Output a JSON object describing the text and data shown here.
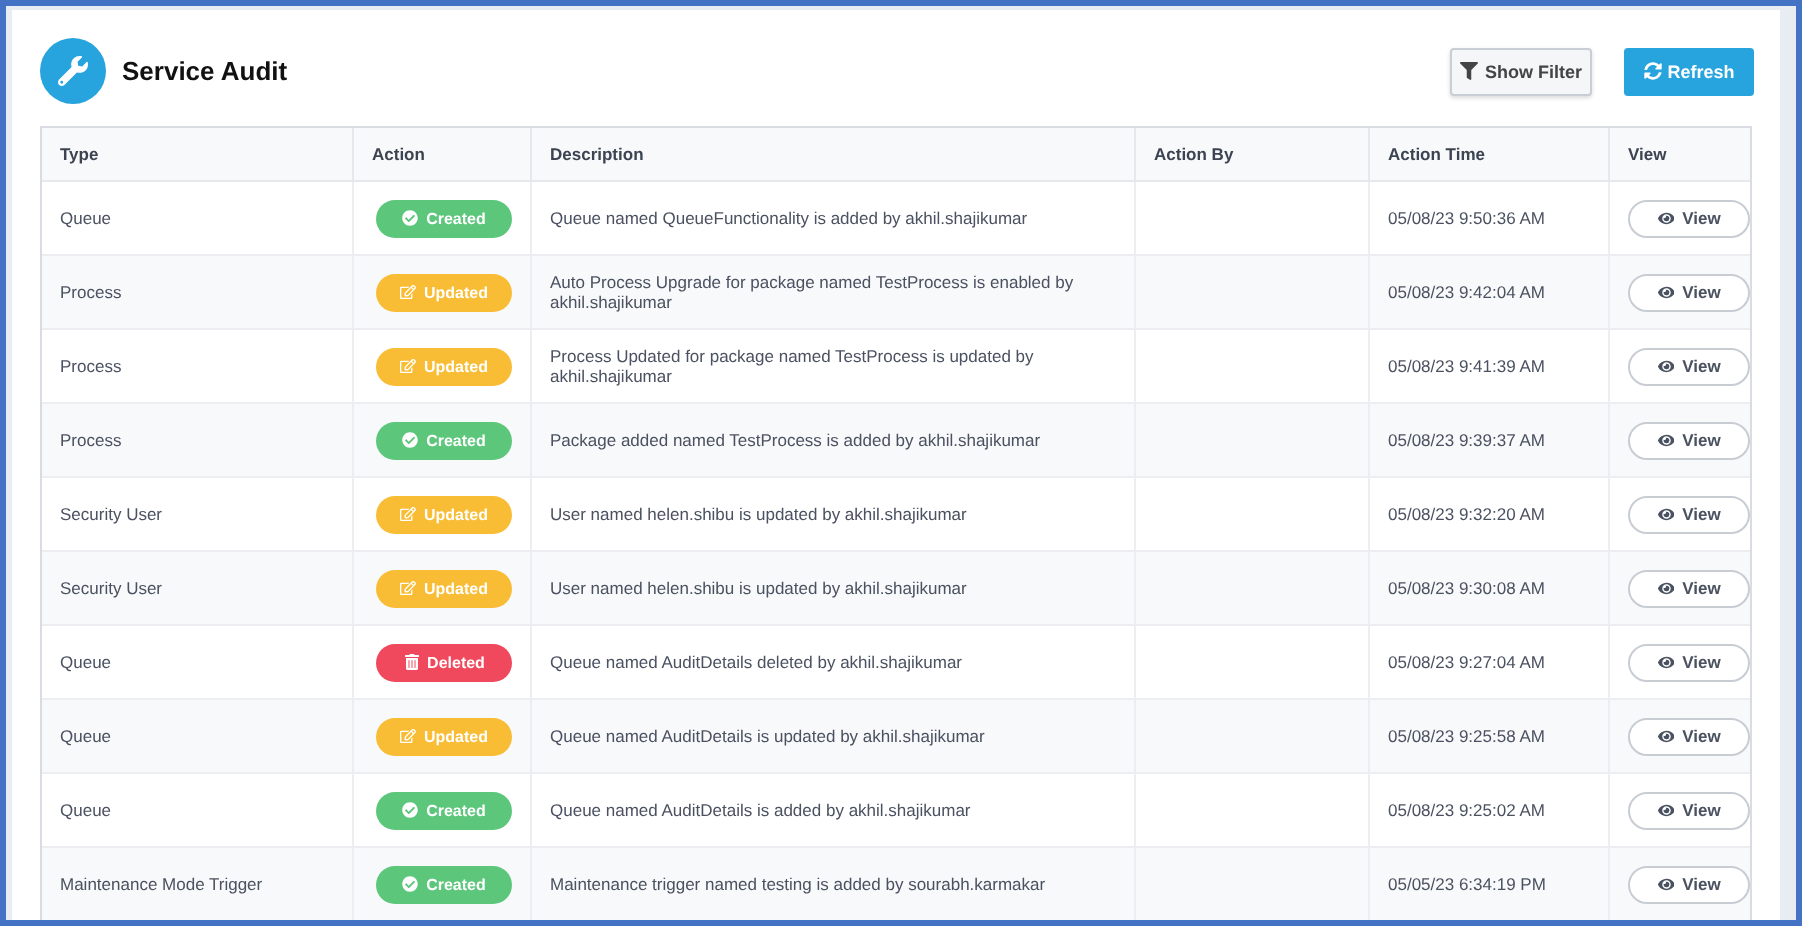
{
  "header": {
    "title": "Service Audit"
  },
  "toolbar": {
    "filter_button": "Show Filter",
    "refresh_button": "Refresh"
  },
  "table": {
    "columns": [
      "Type",
      "Action",
      "Description",
      "Action By",
      "Action Time",
      "View"
    ],
    "rows": [
      {
        "type": "Queue",
        "action": {
          "kind": "created",
          "label": "Created"
        },
        "description": "Queue named QueueFunctionality is added by akhil.shajikumar",
        "time": "05/08/23 9:50:36 AM",
        "view": "View"
      },
      {
        "type": "Process",
        "action": {
          "kind": "updated",
          "label": "Updated"
        },
        "description": "Auto Process Upgrade for package named TestProcess is enabled by akhil.shajikumar",
        "time": "05/08/23 9:42:04 AM",
        "view": "View"
      },
      {
        "type": "Process",
        "action": {
          "kind": "updated",
          "label": "Updated"
        },
        "description": "Process Updated for package named TestProcess is updated by akhil.shajikumar",
        "time": "05/08/23 9:41:39 AM",
        "view": "View"
      },
      {
        "type": "Process",
        "action": {
          "kind": "created",
          "label": "Created"
        },
        "description": "Package added named TestProcess is added by akhil.shajikumar",
        "time": "05/08/23 9:39:37 AM",
        "view": "View"
      },
      {
        "type": "Security User",
        "action": {
          "kind": "updated",
          "label": "Updated"
        },
        "description": "User named helen.shibu is updated by akhil.shajikumar",
        "time": "05/08/23 9:32:20 AM",
        "view": "View"
      },
      {
        "type": "Security User",
        "action": {
          "kind": "updated",
          "label": "Updated"
        },
        "description": "User named helen.shibu is updated by akhil.shajikumar",
        "time": "05/08/23 9:30:08 AM",
        "view": "View"
      },
      {
        "type": "Queue",
        "action": {
          "kind": "deleted",
          "label": "Deleted"
        },
        "description": "Queue named AuditDetails deleted by akhil.shajikumar",
        "time": "05/08/23 9:27:04 AM",
        "view": "View"
      },
      {
        "type": "Queue",
        "action": {
          "kind": "updated",
          "label": "Updated"
        },
        "description": "Queue named AuditDetails is updated by akhil.shajikumar",
        "time": "05/08/23 9:25:58 AM",
        "view": "View"
      },
      {
        "type": "Queue",
        "action": {
          "kind": "created",
          "label": "Created"
        },
        "description": "Queue named AuditDetails is added by akhil.shajikumar",
        "time": "05/08/23 9:25:02 AM",
        "view": "View"
      },
      {
        "type": "Maintenance Mode Trigger",
        "action": {
          "kind": "created",
          "label": "Created"
        },
        "description": "Maintenance trigger named testing is added by sourabh.karmakar",
        "time": "05/05/23 6:34:19 PM",
        "view": "View"
      }
    ]
  }
}
